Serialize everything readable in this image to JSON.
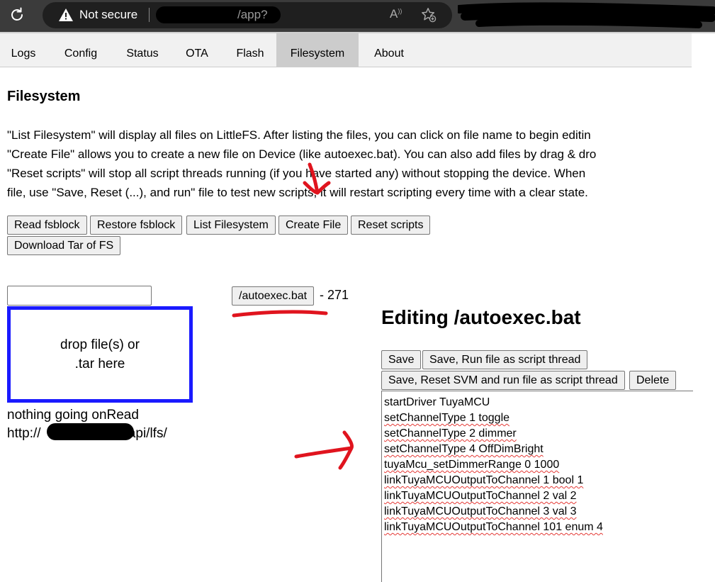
{
  "browser": {
    "security_label": "Not secure",
    "url_path": "/app?"
  },
  "tabs": [
    {
      "label": "Logs",
      "active": false
    },
    {
      "label": "Config",
      "active": false
    },
    {
      "label": "Status",
      "active": false
    },
    {
      "label": "OTA",
      "active": false
    },
    {
      "label": "Flash",
      "active": false
    },
    {
      "label": "Filesystem",
      "active": true
    },
    {
      "label": "About",
      "active": false
    }
  ],
  "page": {
    "title": "Filesystem",
    "description_lines": [
      "\"List Filesystem\" will display all files on LittleFS. After listing the files, you can click on file name to begin editin",
      "\"Create File\" allows you to create a new file on Device (like autoexec.bat). You can also add files by drag & dro",
      "\"Reset scripts\" will stop all script threads running (if you have started any) without stopping the device. When",
      "file, use \"Save, Reset (...), and run\" file to test new scripts, it will restart scripting every time with a clear state."
    ]
  },
  "toolbar": {
    "read_fsblock": "Read fsblock",
    "restore_fsblock": "Restore fsblock",
    "list_filesystem": "List Filesystem",
    "create_file": "Create File",
    "reset_scripts": "Reset scripts",
    "download_tar": "Download Tar of FS"
  },
  "upload": {
    "filename_value": "",
    "drop_line1": "drop file(s) or",
    "drop_line2": ".tar here",
    "status": "nothing going onRead",
    "url_prefix": "http://",
    "url_suffix": "/api/lfs/"
  },
  "file_list": [
    {
      "name": "/autoexec.bat",
      "size": "- 271"
    }
  ],
  "editor": {
    "title": "Editing /autoexec.bat",
    "save": "Save",
    "save_run": "Save, Run file as script thread",
    "save_reset_run": "Save, Reset SVM and run file as script thread",
    "delete": "Delete",
    "lines": [
      "startDriver TuyaMCU",
      "setChannelType 1 toggle",
      "setChannelType 2 dimmer",
      "setChannelType 4 OffDimBright",
      "tuyaMcu_setDimmerRange 0 1000",
      "linkTuyaMCUOutputToChannel 1 bool 1",
      "linkTuyaMCUOutputToChannel 2 val 2",
      "linkTuyaMCUOutputToChannel 3 val 3",
      "linkTuyaMCUOutputToChannel 101 enum 4"
    ]
  },
  "colors": {
    "annotation_red": "#e0141e",
    "dropzone_border": "#1a1aff",
    "active_tab": "#cccccc"
  }
}
